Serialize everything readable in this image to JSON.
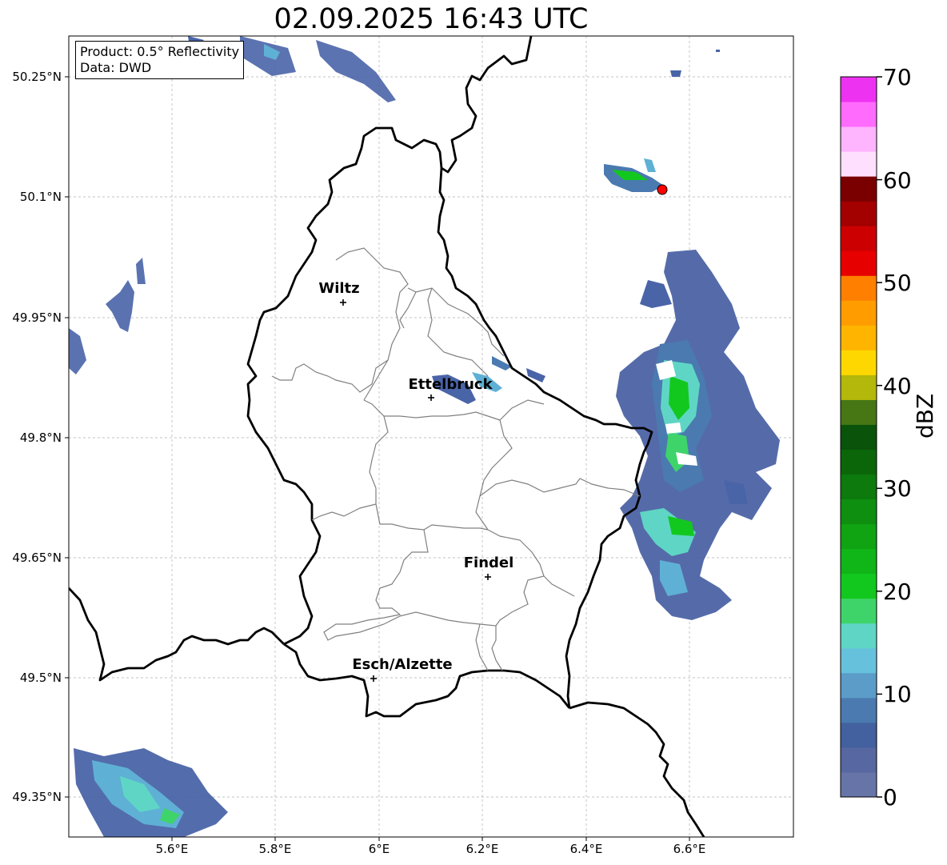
{
  "title": "02.09.2025 16:43 UTC",
  "info": {
    "product": "Product: 0.5° Reflectivity",
    "data_source": "Data: DWD"
  },
  "lat_labels": [
    "50.25°N",
    "50.1°N",
    "49.95°N",
    "49.8°N",
    "49.65°N",
    "49.5°N",
    "49.35°N"
  ],
  "lon_labels": [
    "5.6°E",
    "5.8°E",
    "6°E",
    "6.2°E",
    "6.4°E",
    "6.6°E"
  ],
  "cities": [
    {
      "name": "Wiltz",
      "lon": 5.93,
      "lat": 49.966
    },
    {
      "name": "Ettelbruck",
      "lon": 6.1,
      "lat": 49.846
    },
    {
      "name": "Findel",
      "lon": 6.21,
      "lat": 49.627
    },
    {
      "name": "Esch/Alzette",
      "lon": 5.99,
      "lat": 49.497
    }
  ],
  "radar_site": {
    "lon": 6.548,
    "lat": 50.109,
    "color": "#ff0000"
  },
  "colorbar": {
    "unit": "dBZ",
    "ticks": [
      "0",
      "10",
      "20",
      "30",
      "40",
      "50",
      "60",
      "70"
    ],
    "colors": [
      "#6674a8",
      "#5667a1",
      "#43609f",
      "#4a7ab0",
      "#5b9cc8",
      "#66c1dc",
      "#5fd6c5",
      "#3ed46a",
      "#12c81e",
      "#10b518",
      "#10a312",
      "#0e8f10",
      "#0c7a0c",
      "#0b6609",
      "#0a530a",
      "#467714",
      "#b4b80a",
      "#ffd700",
      "#ffb500",
      "#ff9d00",
      "#ff7f00",
      "#e60000",
      "#cc0000",
      "#a30000",
      "#7a0000",
      "#fee0fe",
      "#ffb4fe",
      "#ff6bfd",
      "#ee32f2"
    ]
  },
  "map": {
    "lon_range": [
      5.4,
      6.8
    ],
    "lat_range": [
      49.3,
      50.3
    ]
  }
}
